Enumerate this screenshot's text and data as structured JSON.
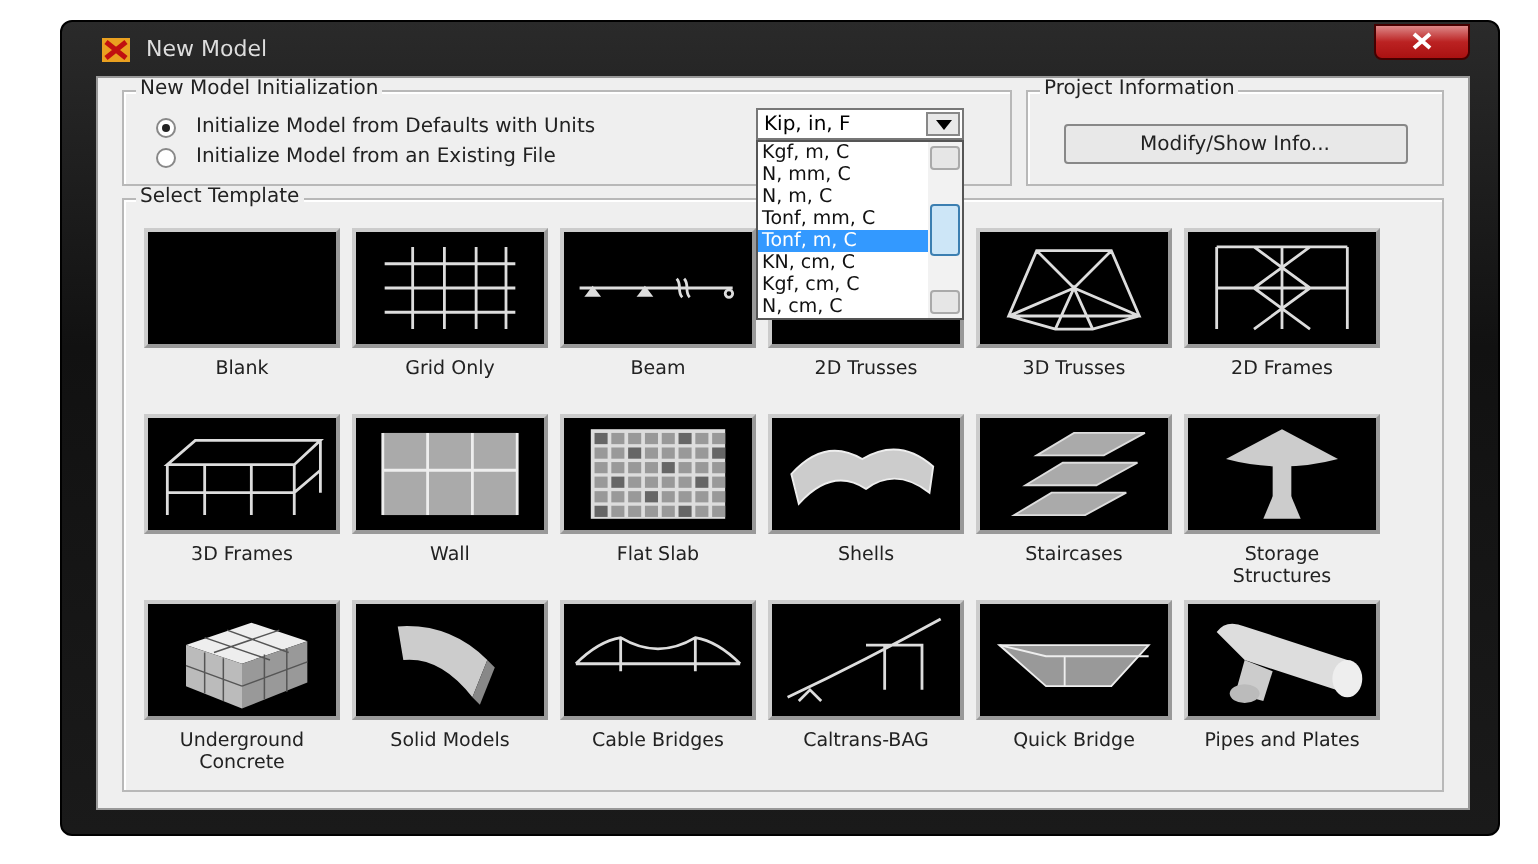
{
  "window": {
    "title": "New Model"
  },
  "initialization": {
    "title": "New Model Initialization",
    "options": [
      {
        "label": "Initialize Model from Defaults with Units",
        "selected": true
      },
      {
        "label": "Initialize Model  from an Existing File",
        "selected": false
      }
    ],
    "units": {
      "value": "Kip, in, F",
      "expanded": true,
      "options": [
        {
          "label": "Kgf, m, C",
          "selected": false
        },
        {
          "label": "N, mm, C",
          "selected": false
        },
        {
          "label": "N, m, C",
          "selected": false
        },
        {
          "label": "Tonf, mm, C",
          "selected": false
        },
        {
          "label": "Tonf, m, C",
          "selected": true
        },
        {
          "label": "KN, cm, C",
          "selected": false
        },
        {
          "label": "Kgf, cm, C",
          "selected": false
        },
        {
          "label": "N, cm, C",
          "selected": false
        }
      ]
    }
  },
  "project": {
    "title": "Project Information",
    "button": "Modify/Show Info..."
  },
  "templates": {
    "title": "Select Template",
    "items": [
      {
        "label": "Blank"
      },
      {
        "label": "Grid Only"
      },
      {
        "label": "Beam"
      },
      {
        "label": "2D Trusses"
      },
      {
        "label": "3D Trusses"
      },
      {
        "label": "2D Frames"
      },
      {
        "label": "3D Frames"
      },
      {
        "label": "Wall"
      },
      {
        "label": "Flat Slab"
      },
      {
        "label": "Shells"
      },
      {
        "label": "Staircases"
      },
      {
        "label": "Storage Structures"
      },
      {
        "label": "Underground Concrete"
      },
      {
        "label": "Solid Models"
      },
      {
        "label": "Cable Bridges"
      },
      {
        "label": "Caltrans-BAG"
      },
      {
        "label": "Quick Bridge"
      },
      {
        "label": "Pipes and Plates"
      }
    ]
  }
}
